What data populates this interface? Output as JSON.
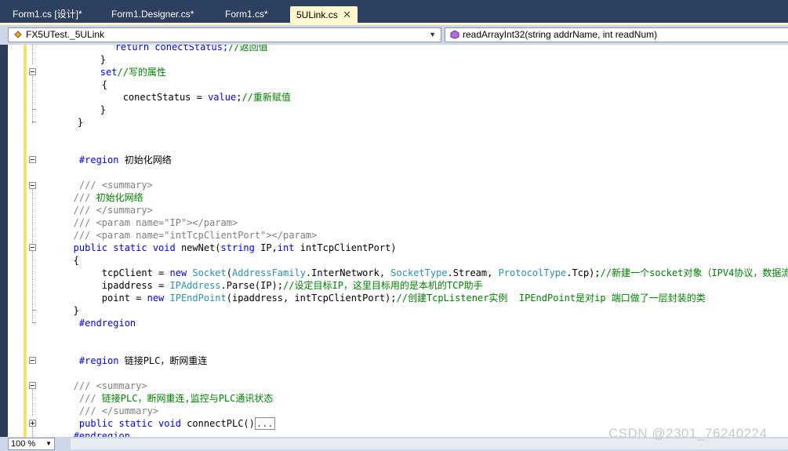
{
  "tabs": [
    {
      "label": "Form1.cs [设计]*"
    },
    {
      "label": "Form1.Designer.cs*"
    },
    {
      "label": "Form1.cs*"
    },
    {
      "label": "5ULink.cs",
      "close": "✕"
    }
  ],
  "nav": {
    "class_combo": "FX5UTest._5ULink",
    "member_combo": "readArrayInt32(string addrName, int readNum)"
  },
  "code": {
    "l0": [
      "            return conectStatus;",
      "//返回值"
    ],
    "l1": "        }",
    "l2": [
      "        set",
      "//写的属性"
    ],
    "l3": "        {",
    "l4": [
      "            conectStatus = ",
      "value",
      ";",
      "//重新赋值"
    ],
    "l5": "        }",
    "l6": "    }",
    "l7": [
      "    #region",
      " 初始化网络"
    ],
    "l8": [
      "    /// ",
      "<summary>"
    ],
    "l9": [
      "   /// ",
      "初始化网络"
    ],
    "l10": [
      "   /// ",
      "</summary>"
    ],
    "l11": [
      "   /// ",
      "<param name=\"IP\"></param>"
    ],
    "l12": [
      "   /// ",
      "<param name=\"intTcpClientPort\"></param>"
    ],
    "l13": [
      "   public static void",
      " newNet(",
      "string",
      " IP,",
      "int",
      " intTcpClientPort)"
    ],
    "l14": "   {",
    "l15": [
      "        tcpClient = ",
      "new ",
      "Socket",
      "(",
      "AddressFamily",
      ".InterNetwork, ",
      "SocketType",
      ".Stream, ",
      "ProtocolType",
      ".Tcp);",
      "//新建一个socket对象（IPV4协议，数据流"
    ],
    "l16": [
      "        ipaddress = ",
      "IPAddress",
      ".Parse(IP);",
      "//设定目标IP，这里目标用的是本机的TCP助手"
    ],
    "l17": [
      "        point = ",
      "new ",
      "IPEndPoint",
      "(ipaddress, intTcpClientPort);",
      "//创建TcpListener实例  IPEndPoint是对ip 端口做了一层封装的类"
    ],
    "l18": "   }",
    "l19": [
      "    #endregion"
    ],
    "l20": [
      "    #region",
      " 链接PLC，断网重连"
    ],
    "l21": [
      "   /// ",
      "<summary>"
    ],
    "l22": [
      "    /// ",
      "链接PLC，断网重连,监控与PLC通讯状态"
    ],
    "l23": [
      "    /// ",
      "</summary>"
    ],
    "l24": [
      "    public static void",
      " connectPLC()",
      "..."
    ],
    "l25": [
      "   #endregion"
    ]
  },
  "zoom": "100 %",
  "watermark": "CSDN @2301_76240224",
  "colors": {
    "keyword": "#0000ff",
    "comment": "#008000",
    "type": "#2b91af",
    "doc_tag": "#808080"
  }
}
